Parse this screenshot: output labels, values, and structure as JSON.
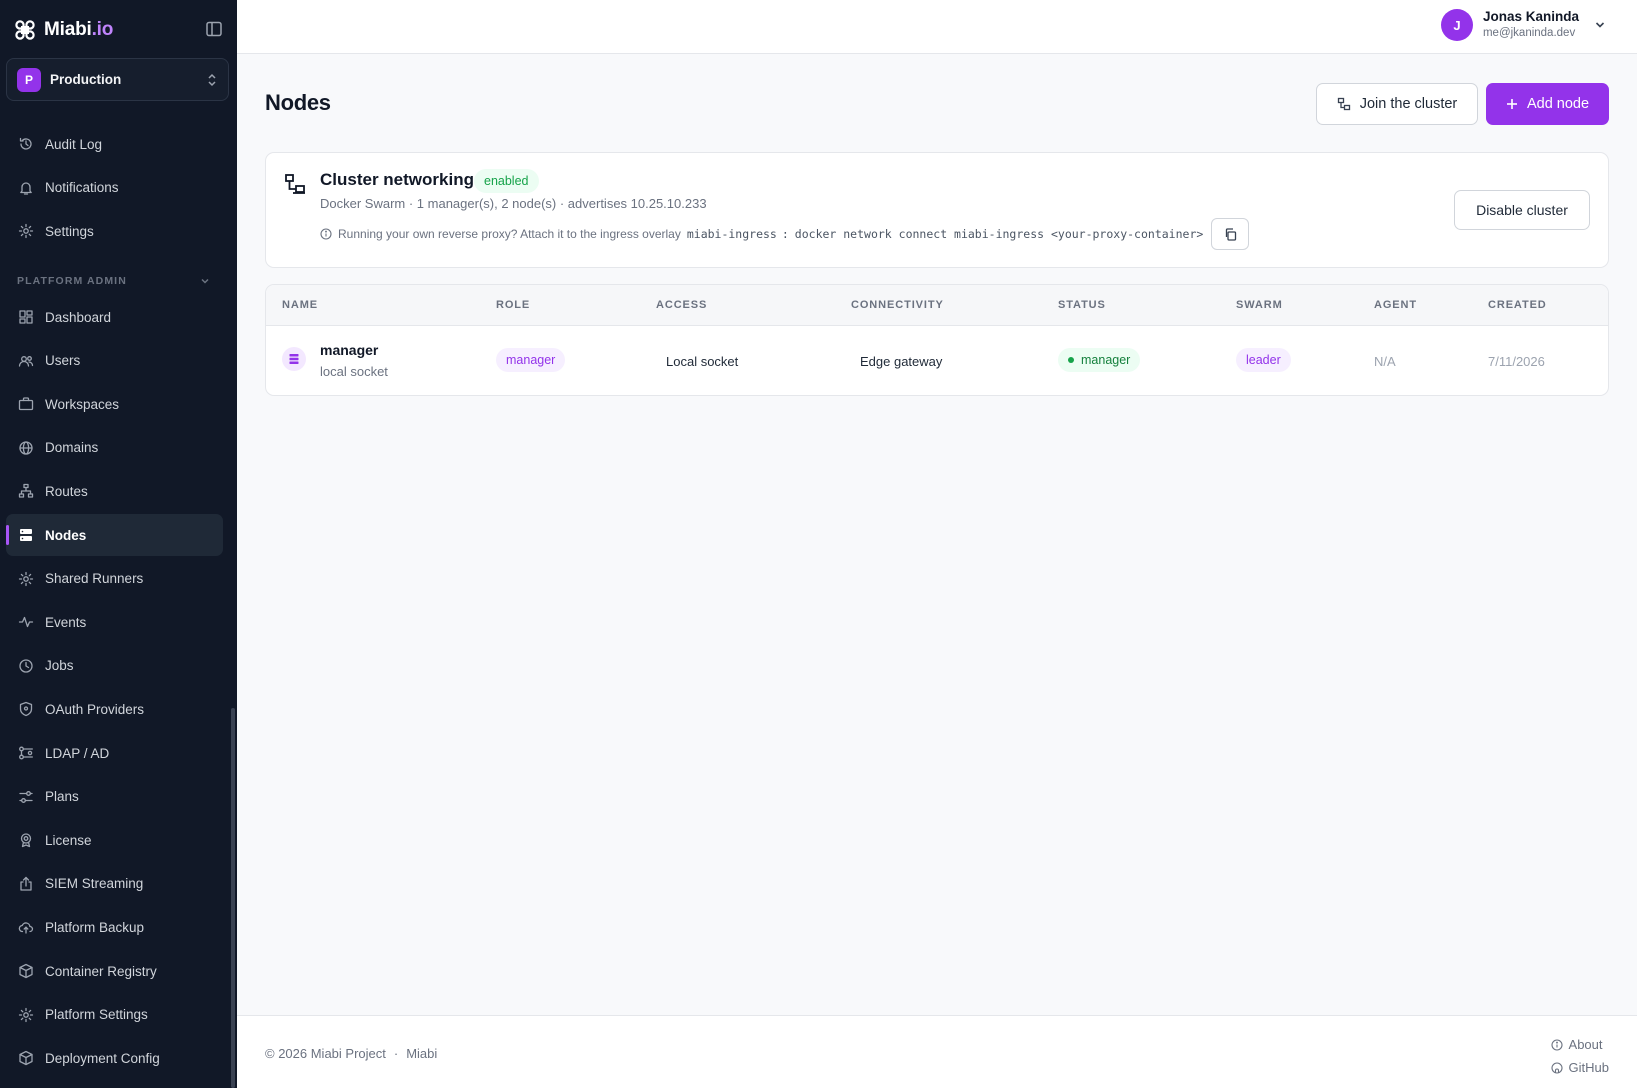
{
  "brand": {
    "name_main": "Miabi",
    "name_accent": ".io"
  },
  "workspace": {
    "initial": "P",
    "name": "Production"
  },
  "sidebar": {
    "top_items": [
      {
        "label": "Audit Log",
        "icon": "history-icon"
      },
      {
        "label": "Notifications",
        "icon": "bell-icon"
      },
      {
        "label": "Settings",
        "icon": "gear-icon"
      }
    ],
    "section_label": "PLATFORM ADMIN",
    "admin_items": [
      {
        "label": "Dashboard",
        "icon": "dashboard-icon"
      },
      {
        "label": "Users",
        "icon": "users-icon"
      },
      {
        "label": "Workspaces",
        "icon": "briefcase-icon"
      },
      {
        "label": "Domains",
        "icon": "globe-icon"
      },
      {
        "label": "Routes",
        "icon": "sitemap-icon"
      },
      {
        "label": "Nodes",
        "icon": "server-icon",
        "active": true
      },
      {
        "label": "Shared Runners",
        "icon": "gear-icon"
      },
      {
        "label": "Events",
        "icon": "activity-icon"
      },
      {
        "label": "Jobs",
        "icon": "clock-icon"
      },
      {
        "label": "OAuth Providers",
        "icon": "shield-icon"
      },
      {
        "label": "LDAP / AD",
        "icon": "directory-icon"
      },
      {
        "label": "Plans",
        "icon": "sliders-icon"
      },
      {
        "label": "License",
        "icon": "award-icon"
      },
      {
        "label": "SIEM Streaming",
        "icon": "export-icon"
      },
      {
        "label": "Platform Backup",
        "icon": "cloud-upload-icon"
      },
      {
        "label": "Container Registry",
        "icon": "box-icon"
      },
      {
        "label": "Platform Settings",
        "icon": "gear-icon"
      },
      {
        "label": "Deployment Config",
        "icon": "box-icon"
      }
    ]
  },
  "user": {
    "initial": "J",
    "name": "Jonas Kaninda",
    "email": "me@jkaninda.dev"
  },
  "page": {
    "title": "Nodes",
    "join_label": "Join the cluster",
    "add_label": "Add node"
  },
  "cluster": {
    "title": "Cluster networking",
    "status": "enabled",
    "subtitle": "Docker Swarm · 1 manager(s), 2 node(s) · advertises 10.25.10.233",
    "hint": "Running your own reverse proxy? Attach it to the ingress overlay",
    "network_name": "miabi-ingress",
    "separator": ":",
    "command": "docker network connect miabi-ingress <your-proxy-container>",
    "disable_label": "Disable cluster"
  },
  "table": {
    "headers": [
      "NAME",
      "ROLE",
      "ACCESS",
      "CONNECTIVITY",
      "STATUS",
      "SWARM",
      "AGENT",
      "CREATED"
    ],
    "rows": [
      {
        "name": "manager",
        "subtitle": "local socket",
        "role": "manager",
        "access": "Local socket",
        "connectivity": "Edge gateway",
        "status": "manager",
        "swarm": "leader",
        "agent": "N/A",
        "created": "7/11/2026"
      }
    ]
  },
  "footer": {
    "copyright": "© 2026 Miabi Project",
    "dot": "·",
    "product": "Miabi",
    "links": [
      "About",
      "GitHub"
    ]
  },
  "colors": {
    "accent": "#9333ea",
    "sidebar_bg": "#111827",
    "success": "#16a34a"
  }
}
